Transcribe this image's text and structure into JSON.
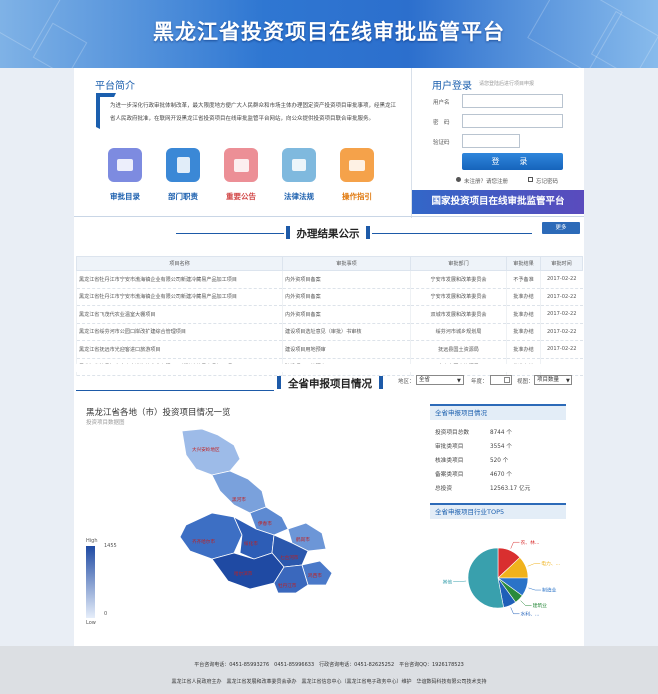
{
  "site": {
    "title": "黑龙江省投资项目在线审批监管平台"
  },
  "intro": {
    "title": "平台简介",
    "text": "为进一步深化行政审批体制改革，最大限度地方便广大人民群众和市场主体办理固定资产投资项目审批事项，经黑龙江省人民政府批准，在联网开设黑龙江省投资项目在线审批监管平台网站，向公众提供投资项目联合审批服务。"
  },
  "quick_links": [
    {
      "label": "审批目录",
      "color": "#7d8be0",
      "text_color": "#1b5fae"
    },
    {
      "label": "部门职责",
      "color": "#3b88d6",
      "text_color": "#1b5fae"
    },
    {
      "label": "重要公告",
      "color": "#ec8f96",
      "text_color": "#d24a4a"
    },
    {
      "label": "法律法规",
      "color": "#7fb9de",
      "text_color": "#1b5fae"
    },
    {
      "label": "操作指引",
      "color": "#f5a24a",
      "text_color": "#e07a10"
    }
  ],
  "login": {
    "title": "用户登录",
    "subtitle": "请您登陆后进行项目申报",
    "username_label": "用户名",
    "username_value": "",
    "password_label": "密　码",
    "password_value": "",
    "captcha_label": "验证码",
    "captcha_value": "",
    "submit_label": "登　录",
    "register_label": "未注册？请您注册",
    "forgot_label": "忘记密码"
  },
  "national_link": "国家投资项目在线审批监管平台",
  "results": {
    "title": "办理结果公示",
    "more_label": "更多",
    "columns": [
      "项目名称",
      "审批事项",
      "审批部门",
      "审批结果",
      "审批时间"
    ],
    "rows": [
      [
        "黑龙江省牡丹江市宁安市渤海镇企业有限公司新建冷藏易产品加工项目",
        "内外资项目备案",
        "宁安市发展和改革委员会",
        "不予备准",
        "2017-02-22"
      ],
      [
        "黑龙江省牡丹江市宁安市渤海镇企业有限公司新建冷藏易产品加工项目",
        "内外资项目备案",
        "宁安市发展和改革委员会",
        "批准办结",
        "2017-02-22"
      ],
      [
        "黑龙江省飞茂代农业温室大棚项目",
        "内外资项目备案",
        "双城市发展和改革委员会",
        "批准办结",
        "2017-02-22"
      ],
      [
        "黑龙江省绥芬河市公园口岸改扩建综合管理项目",
        "建设项目选址意见（审批）书审核",
        "绥芬河市城乡规划局",
        "批准办结",
        "2017-02-22"
      ],
      [
        "黑龙江省抚远市光迎客进口旅游项目",
        "建设项目用地预审",
        "抚远县国土资源局",
        "批准办结",
        "2017-02-22"
      ],
      [
        "黑龙江省牡丹江市宁安市渤海镇企业有限公司新建冷藏易产品加工项目",
        "建设项目用地预审",
        "宁安市国土资源局",
        "批准办结",
        "2017-02-22"
      ]
    ]
  },
  "province": {
    "title": "全省申报项目情况",
    "region_label": "地区：",
    "region_value": "全省",
    "year_label": "年度：",
    "year_value": "",
    "view_label": "视图：",
    "view_value": "项目数量"
  },
  "map": {
    "title": "黑龙江省各地（市）投资项目情况一览",
    "subtitle": "投资项目数据图",
    "legend_high": "High",
    "legend_max": "1455",
    "legend_min": "0",
    "legend_low": "Low",
    "regions": [
      "大兴安岭地区",
      "黑河市",
      "伊春市",
      "齐齐哈尔市",
      "绥化市",
      "鹤岗市",
      "哈尔滨市",
      "七台河市",
      "鸡西市",
      "牡丹江市"
    ]
  },
  "stats": {
    "title": "全省申报项目情况",
    "rows": [
      {
        "label": "投资项目总数",
        "value": "8744 个"
      },
      {
        "label": "审批类项目",
        "value": "3554 个"
      },
      {
        "label": "核准类项目",
        "value": "520 个"
      },
      {
        "label": "备案类项目",
        "value": "4670 个"
      },
      {
        "label": "总投资",
        "value": "12563.17 亿元"
      }
    ]
  },
  "industry": {
    "title": "全省申报项目行业TOP5"
  },
  "chart_data": {
    "type": "pie",
    "categories": [
      "农、林...",
      "电力、...",
      "制造业",
      "建筑业",
      "水利、...",
      "其他"
    ],
    "values": [
      13,
      12,
      10,
      5,
      7,
      53
    ],
    "colors": [
      "#d92f2f",
      "#f0b21c",
      "#2a73c8",
      "#2a8a3c",
      "#1f5fb8",
      "#39a0ad"
    ]
  },
  "footer": {
    "contacts": "平台咨询电话：0451-85993276　0451-85996633　行政咨询电话：0451-82625252　平台咨询QQ：1926178523",
    "orgs": "黑龙江省人民政府主办　黑龙江省发展和改革委员会承办　黑龙江省信息中心（黑龙江省电子政务中心）维护　华谊数码科技有限公司技术支持"
  }
}
